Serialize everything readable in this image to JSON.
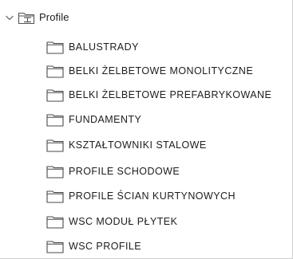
{
  "tree": {
    "root": {
      "label": "Profile",
      "expanded": true,
      "toggle_icon": "chevron-down-icon",
      "icon": "profile-library-icon"
    },
    "children": [
      {
        "label": "BALUSTRADY",
        "icon": "folder-icon"
      },
      {
        "label": "BELKI ŻELBETOWE MONOLITYCZNE",
        "icon": "folder-icon"
      },
      {
        "label": "BELKI ŻELBETOWE PREFABRYKOWANE",
        "icon": "folder-icon"
      },
      {
        "label": "FUNDAMENTY",
        "icon": "folder-icon"
      },
      {
        "label": "KSZTAŁTOWNIKI STALOWE",
        "icon": "folder-icon"
      },
      {
        "label": "PROFILE SCHODOWE",
        "icon": "folder-icon"
      },
      {
        "label": "PROFILE ŚCIAN KURTYNOWYCH",
        "icon": "folder-icon"
      },
      {
        "label": "WSC MODUŁ PŁYTEK",
        "icon": "folder-icon"
      },
      {
        "label": "WSC PROFILE",
        "icon": "folder-icon"
      }
    ]
  }
}
